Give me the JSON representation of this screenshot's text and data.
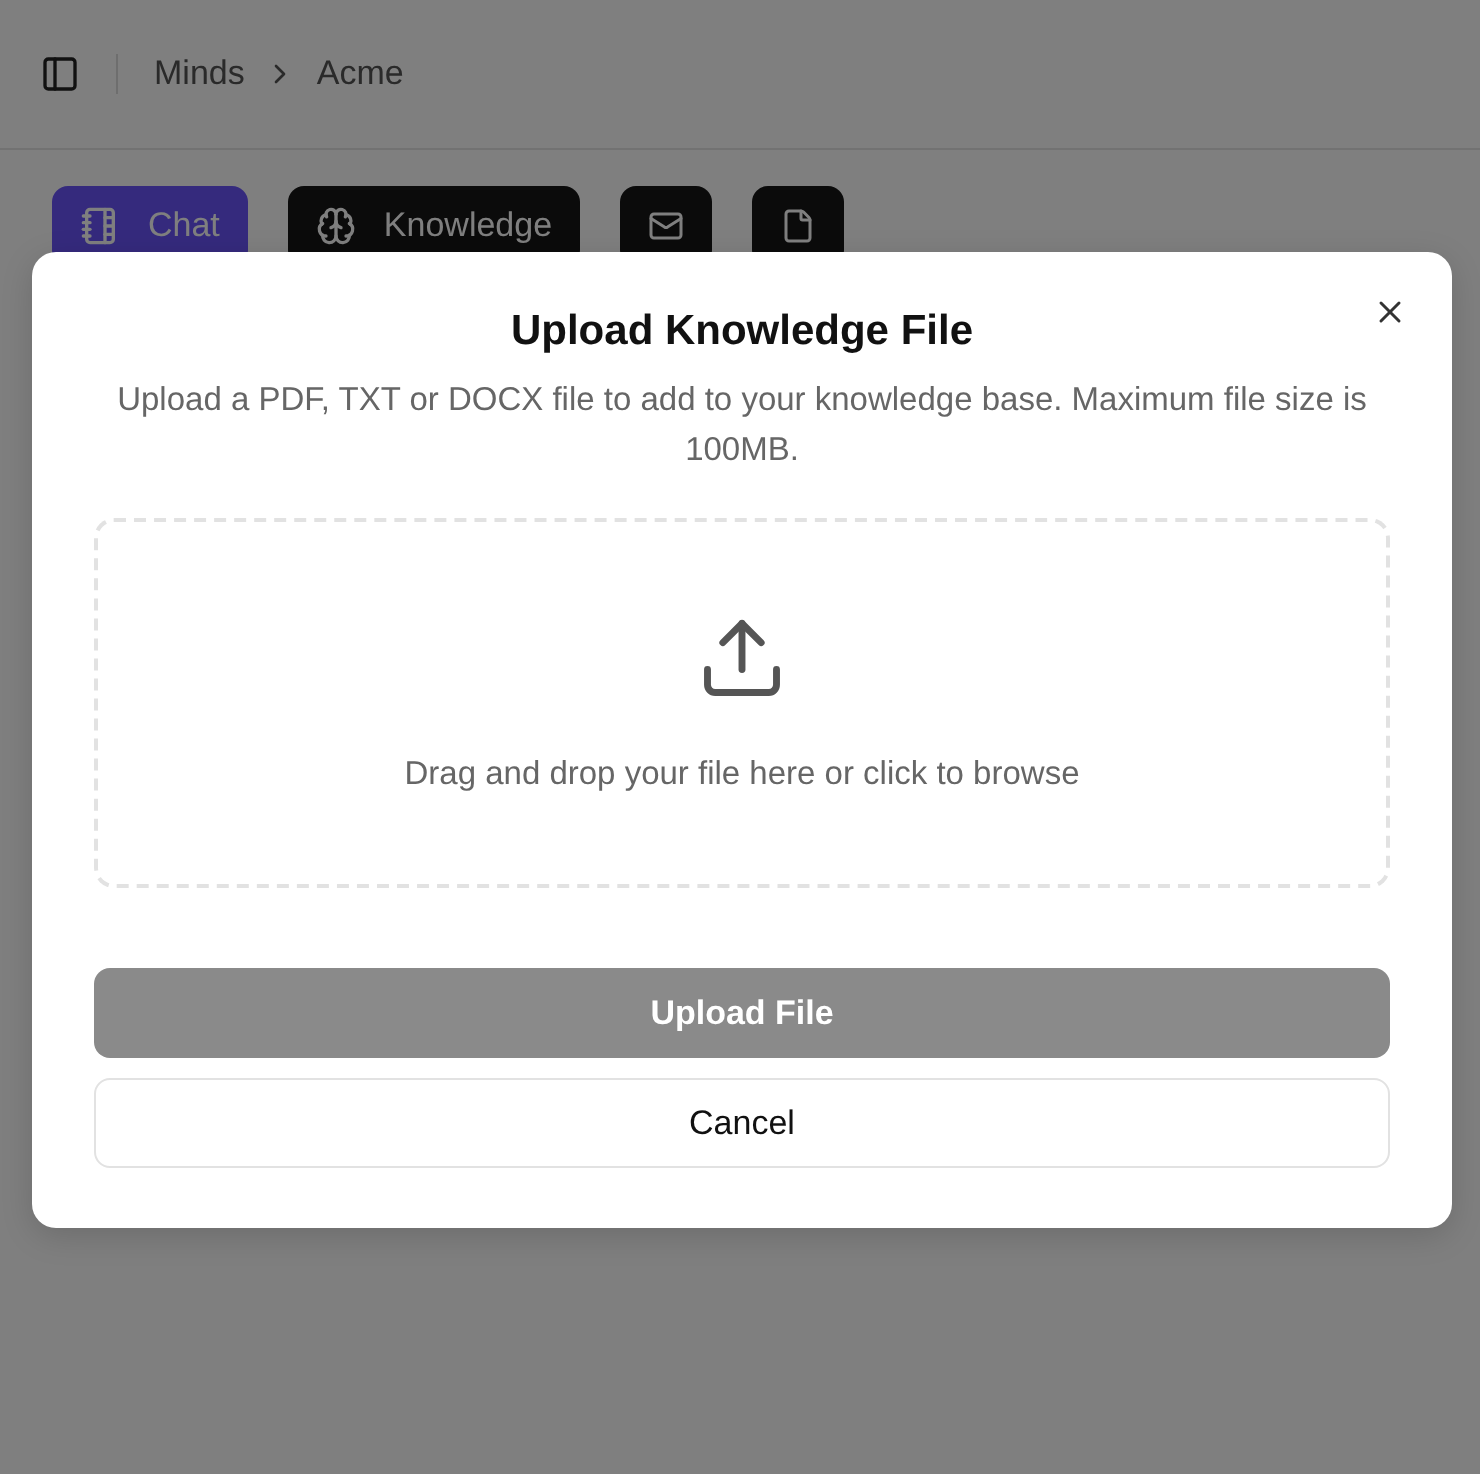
{
  "breadcrumb": [
    "Minds",
    "Acme"
  ],
  "tabs": [
    {
      "kind": "labeled",
      "label": "Chat",
      "selected": true
    },
    {
      "kind": "labeled",
      "label": "Knowledge",
      "selected": false
    },
    {
      "kind": "icon",
      "selected": false
    },
    {
      "kind": "icon",
      "selected": false
    }
  ],
  "dialog": {
    "title": "Upload Knowledge File",
    "description": "Upload a PDF, TXT or DOCX file to add to your knowledge base. Maximum file size is 100MB.",
    "dropzone": "Drag and drop your file here or click to browse",
    "upload_button": {
      "label": "Upload File",
      "disabled": true
    },
    "cancel_button": "Cancel"
  }
}
